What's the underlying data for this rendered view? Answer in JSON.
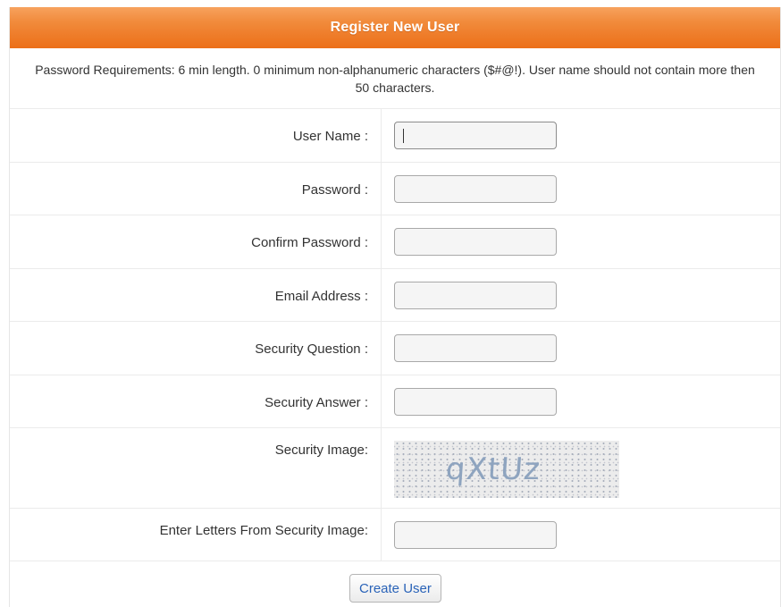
{
  "form": {
    "title": "Register New User",
    "requirements": "Password Requirements: 6 min length. 0 minimum non-alphanumeric characters ($#@!). User name should not contain more then 50 characters.",
    "fields": {
      "username": {
        "label": "User Name :",
        "value": ""
      },
      "password": {
        "label": "Password :",
        "value": ""
      },
      "confirm_password": {
        "label": "Confirm Password :",
        "value": ""
      },
      "email": {
        "label": "Email Address :",
        "value": ""
      },
      "security_question": {
        "label": "Security Question :",
        "value": ""
      },
      "security_answer": {
        "label": "Security Answer :",
        "value": ""
      },
      "security_image": {
        "label": "Security Image:",
        "captcha_text": "qXtUz"
      },
      "captcha_entry": {
        "label": "Enter Letters From Security Image:",
        "value": ""
      }
    },
    "submit_label": "Create User"
  },
  "colors": {
    "header_gradient_top": "#f7a25e",
    "header_gradient_bottom": "#ec6f18",
    "button_text": "#2a63b8",
    "captcha_text": "#8ea4bf"
  }
}
